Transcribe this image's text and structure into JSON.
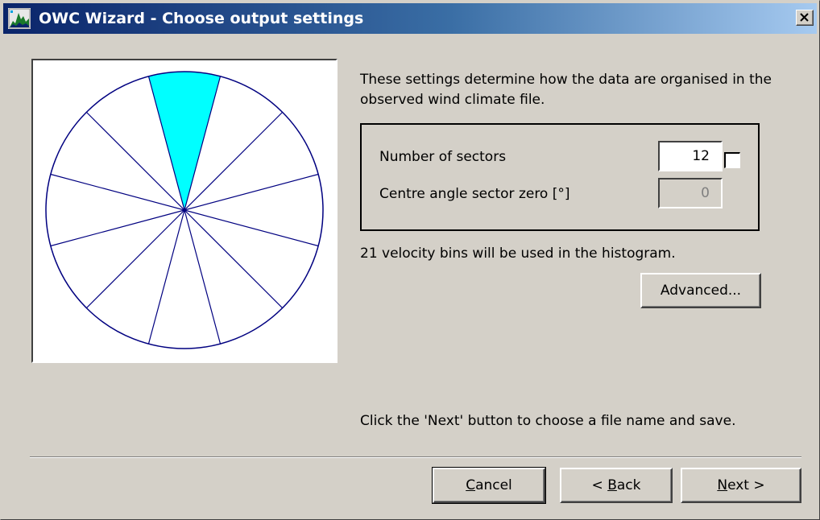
{
  "window": {
    "title": "OWC Wizard - Choose output settings",
    "close_glyph": "×"
  },
  "icons": {
    "app": "owc-wizard-icon",
    "close": "close-icon"
  },
  "preview": {
    "sector_count": 12,
    "highlighted_sector": 0,
    "highlight_color": "#00ffff",
    "line_color": "#000080"
  },
  "intro": "These settings determine how the data are organised in the observed wind climate file.",
  "settings": {
    "sectors_label": "Number of sectors",
    "sectors_value": "12",
    "angle_label": "Centre angle sector zero [°]",
    "angle_value": "0"
  },
  "bins_text": "21 velocity bins will be used in the histogram.",
  "advanced_label": "Advanced...",
  "hint_text": "Click the 'Next' button to choose a file name and save.",
  "buttons": {
    "cancel": {
      "mnemonic": "C",
      "rest": "ancel"
    },
    "back": {
      "prefix": "< ",
      "mnemonic": "B",
      "rest": "ack"
    },
    "next": {
      "mnemonic": "N",
      "rest": "ext >"
    }
  },
  "colors": {
    "dialog_bg": "#d4d0c8",
    "title_gradient_start": "#0a246a",
    "title_gradient_end": "#a6caf0"
  }
}
